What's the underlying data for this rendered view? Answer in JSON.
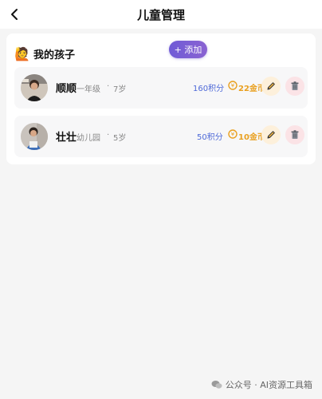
{
  "nav": {
    "title": "儿童管理",
    "back_icon": "chevron-left-icon"
  },
  "section": {
    "emoji": "🙋",
    "title": "我的孩子",
    "add_label": "+ 添加"
  },
  "children": [
    {
      "name": "顺顺",
      "grade": "一年级",
      "separator": "·",
      "age": "7岁",
      "points": "160积分",
      "coins": "22金币"
    },
    {
      "name": "壮壮",
      "grade": "幼儿园",
      "separator": "·",
      "age": "5岁",
      "points": "50积分",
      "coins": "10金币"
    }
  ],
  "watermark": {
    "text": "公众号 · AI资源工具箱",
    "icon": "wechat-icon"
  },
  "colors": {
    "accent": "#7a5cd6",
    "points": "#4f6ad8",
    "coins": "#e9a020",
    "edit_bg": "#fdf0db",
    "delete_bg": "#fbe3e6"
  }
}
